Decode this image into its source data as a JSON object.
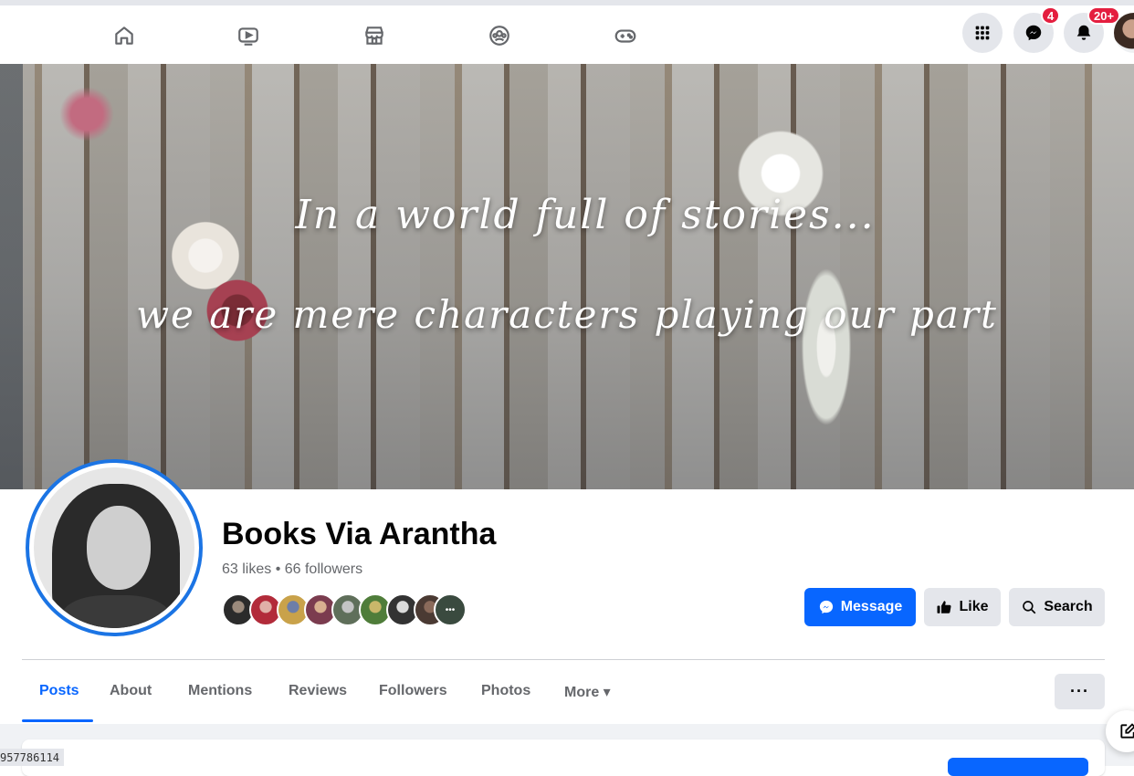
{
  "topnav": {
    "icons": [
      "home-icon",
      "watch-icon",
      "marketplace-icon",
      "groups-icon",
      "gaming-icon"
    ],
    "messenger_badge": "4",
    "notifications_badge": "20+"
  },
  "cover": {
    "line1": "In a world full of stories...",
    "line2": "we are mere characters playing our part"
  },
  "page": {
    "name": "Books Via Arantha",
    "stats": "63 likes • 66 followers"
  },
  "actions": {
    "message": "Message",
    "like": "Like",
    "search": "Search"
  },
  "tabs": [
    {
      "label": "Posts",
      "active": true
    },
    {
      "label": "About"
    },
    {
      "label": "Mentions"
    },
    {
      "label": "Reviews"
    },
    {
      "label": "Followers"
    },
    {
      "label": "Photos"
    },
    {
      "label": "More ▾"
    }
  ],
  "more_options": "···",
  "footer_id": "957786114",
  "colors": {
    "accent": "#0866ff",
    "badge": "#e41e3f",
    "button_gray": "#e4e6eb"
  }
}
